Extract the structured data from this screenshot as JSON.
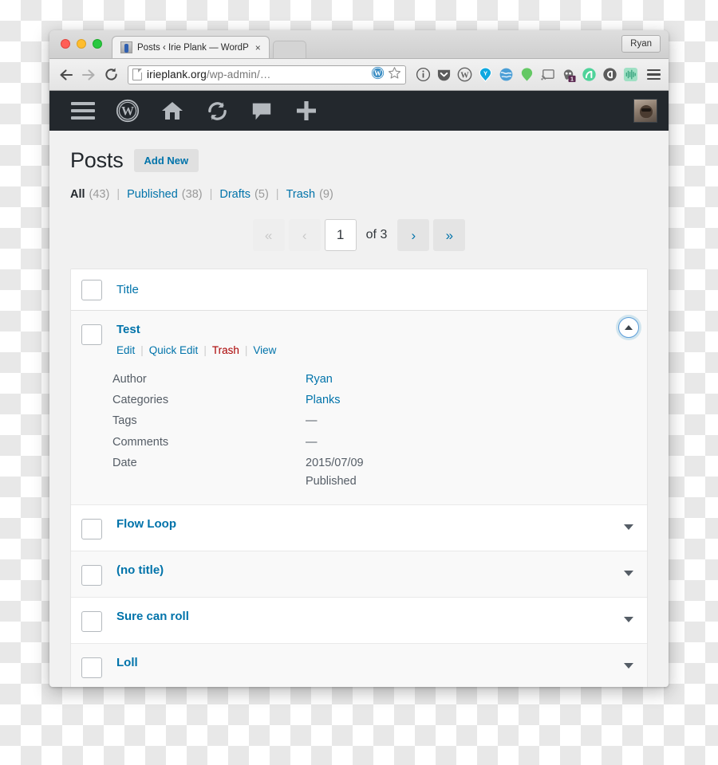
{
  "browser": {
    "tab": {
      "title": "Posts ‹ Irie Plank — WordP",
      "close_label": "×",
      "favicon_name": "site-favicon"
    },
    "profile_button": "Ryan",
    "nav": {
      "back": "back-arrow",
      "forward": "forward-arrow",
      "reload": "reload-icon"
    },
    "omnibox": {
      "url_domain": "irieplank.org",
      "url_path": "/wp-admin/…",
      "full_url": "irieplank.org/wp-admin/…",
      "page_icon": "page-document-icon",
      "inline_icons": [
        "wordpress-icon",
        "bookmark-star-icon"
      ]
    },
    "extensions": [
      "info-circle-icon",
      "pocket-icon",
      "wordpress-icon",
      "yoast-icon",
      "globe-icon",
      "green-pin-icon",
      "chromecast-icon",
      "ghostery-icon",
      "adblock-icon",
      "evernote-icon",
      "soundwave-icon"
    ],
    "extension_badge": "1",
    "menu_icon": "chrome-menu-icon"
  },
  "adminbar": {
    "items": [
      "menu-toggle-icon",
      "wordpress-logo-icon",
      "home-icon",
      "updates-icon",
      "comments-icon",
      "new-content-icon"
    ],
    "avatar_name": "user-avatar"
  },
  "page": {
    "title": "Posts",
    "add_new": "Add New"
  },
  "filters": [
    {
      "label": "All",
      "count": "(43)",
      "current": true
    },
    {
      "label": "Published",
      "count": "(38)",
      "current": false
    },
    {
      "label": "Drafts",
      "count": "(5)",
      "current": false
    },
    {
      "label": "Trash",
      "count": "(9)",
      "current": false
    }
  ],
  "filter_separator": "|",
  "pagination": {
    "first": "«",
    "prev": "‹",
    "current_page": "1",
    "of_total": "of 3",
    "next": "›",
    "last": "»"
  },
  "table": {
    "header": {
      "title_column": "Title"
    },
    "rows": [
      {
        "title": "Test",
        "expanded": true,
        "actions": [
          {
            "label": "Edit",
            "style": "link"
          },
          {
            "label": "Quick Edit",
            "style": "link"
          },
          {
            "label": "Trash",
            "style": "trash"
          },
          {
            "label": "View",
            "style": "link"
          }
        ],
        "action_separator": "|",
        "details": [
          {
            "label": "Author",
            "value": "Ryan",
            "link": true
          },
          {
            "label": "Categories",
            "value": "Planks",
            "link": true
          },
          {
            "label": "Tags",
            "value": "—",
            "link": false
          },
          {
            "label": "Comments",
            "value": "—",
            "link": false
          },
          {
            "label": "Date",
            "value": "2015/07/09",
            "value2": "Published",
            "link": false
          }
        ]
      },
      {
        "title": "Flow Loop",
        "expanded": false
      },
      {
        "title": "(no title)",
        "expanded": false
      },
      {
        "title": "Sure can roll",
        "expanded": false
      },
      {
        "title": "Loll",
        "expanded": false
      }
    ]
  },
  "colors": {
    "wp_blue": "#0073aa",
    "adminbar": "#23282d",
    "trash_red": "#a00000",
    "content_bg": "#f1f1f1"
  }
}
